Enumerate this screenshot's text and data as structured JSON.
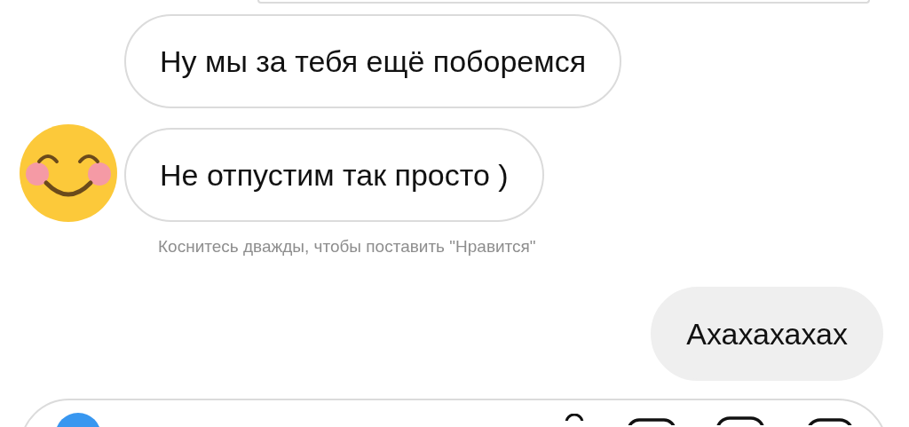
{
  "messages": [
    {
      "text": "Ну мы за тебя ещё поборемся",
      "show_avatar": false
    },
    {
      "text": "Не отпустим так просто )",
      "show_avatar": true
    }
  ],
  "hint": "Коснитесь дважды, чтобы поставить \"Нравится\"",
  "own_messages": [
    {
      "text": "Ахахахахах"
    }
  ]
}
